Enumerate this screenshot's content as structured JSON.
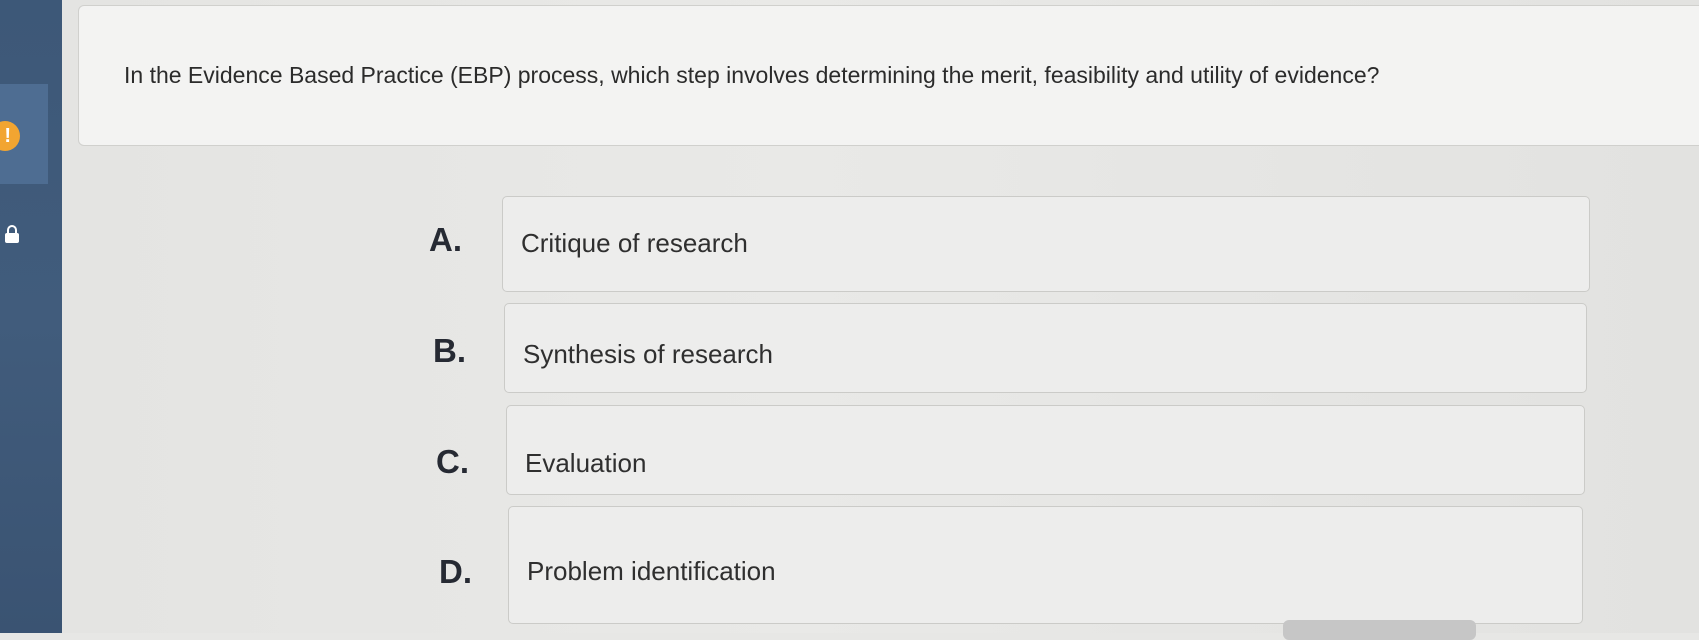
{
  "question": {
    "text": "In the Evidence Based Practice (EBP) process, which step involves determining the merit, feasibility and utility of evidence?"
  },
  "options": [
    {
      "letter": "A.",
      "text": "Critique of research"
    },
    {
      "letter": "B.",
      "text": "Synthesis of research"
    },
    {
      "letter": "C.",
      "text": "Evaluation"
    },
    {
      "letter": "D.",
      "text": "Problem identification"
    }
  ],
  "sidebar": {
    "alert_badge": "!"
  },
  "colors": {
    "sidebar": "#3d5878",
    "alert": "#f2a531",
    "background": "#e7e7e5"
  },
  "icons": [
    "alert-icon",
    "lock-icon"
  ]
}
